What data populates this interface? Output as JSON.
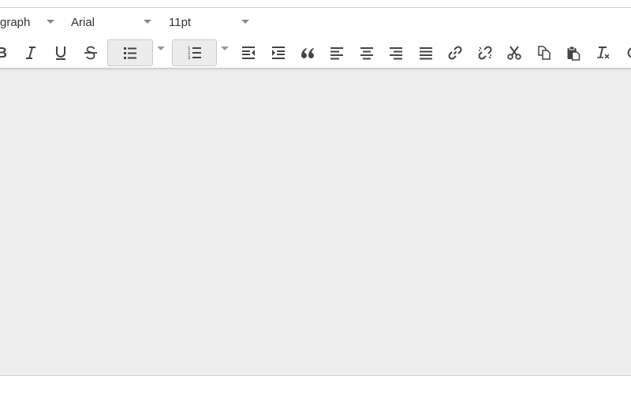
{
  "format_toolbar": {
    "block_format": "Paragraph",
    "block_format_visible": "graph",
    "font_family": "Arial",
    "font_size": "11pt"
  },
  "button_toolbar": {
    "buttons": [
      {
        "name": "bold-button",
        "icon": "bold-icon"
      },
      {
        "name": "italic-button",
        "icon": "italic-icon"
      },
      {
        "name": "underline-button",
        "icon": "underline-icon"
      },
      {
        "name": "strikethrough-button",
        "icon": "strikethrough-icon"
      },
      {
        "name": "bullet-list-button",
        "icon": "bullet-list-icon"
      },
      {
        "name": "numbered-list-button",
        "icon": "numbered-list-icon"
      },
      {
        "name": "outdent-button",
        "icon": "outdent-icon"
      },
      {
        "name": "indent-button",
        "icon": "indent-icon"
      },
      {
        "name": "blockquote-button",
        "icon": "blockquote-icon"
      },
      {
        "name": "align-left-button",
        "icon": "align-left-icon"
      },
      {
        "name": "align-center-button",
        "icon": "align-center-icon"
      },
      {
        "name": "align-right-button",
        "icon": "align-right-icon"
      },
      {
        "name": "justify-button",
        "icon": "justify-icon"
      },
      {
        "name": "link-button",
        "icon": "link-icon"
      },
      {
        "name": "unlink-button",
        "icon": "unlink-icon"
      },
      {
        "name": "cut-button",
        "icon": "scissors-icon"
      },
      {
        "name": "copy-button",
        "icon": "copy-icon"
      },
      {
        "name": "paste-button",
        "icon": "paste-icon"
      },
      {
        "name": "clear-formatting-button",
        "icon": "clear-formatting-icon"
      }
    ]
  },
  "colors": {
    "icon": "#444444",
    "content_background": "#ededed",
    "toolbar_background": "#ffffff",
    "active_button": "#ececec",
    "border": "#cfcfcf"
  }
}
